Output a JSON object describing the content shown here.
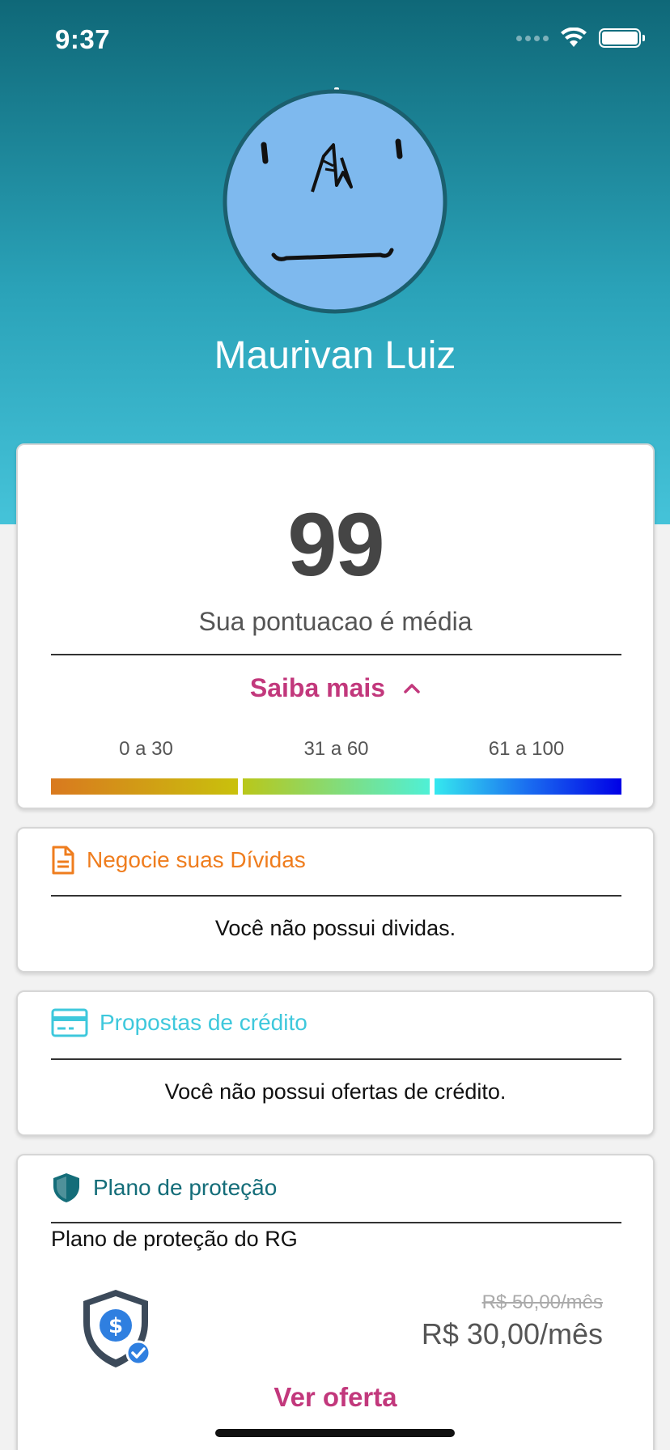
{
  "status_bar": {
    "time": "9:37"
  },
  "profile": {
    "name": "Maurivan Luiz"
  },
  "score": {
    "value": "99",
    "description": "Sua pontuacao é média",
    "learn_more": "Saiba mais",
    "ranges": [
      "0 a 30",
      "31 a 60",
      "61 a 100"
    ]
  },
  "debts": {
    "title": "Negocie suas Dívidas",
    "message": "Você não possui dividas."
  },
  "credit": {
    "title": "Propostas de crédito",
    "message": "Você não possui ofertas de crédito."
  },
  "protection": {
    "title": "Plano de proteção",
    "plan_name": "Plano de proteção do RG",
    "old_price": "R$ 50,00/mês",
    "new_price": "R$ 30,00/mês",
    "cta": "Ver oferta"
  },
  "colors": {
    "accent": "#c2387c",
    "debts": "#ef7d1e",
    "credit": "#3ec8dc",
    "protection": "#146d79"
  }
}
